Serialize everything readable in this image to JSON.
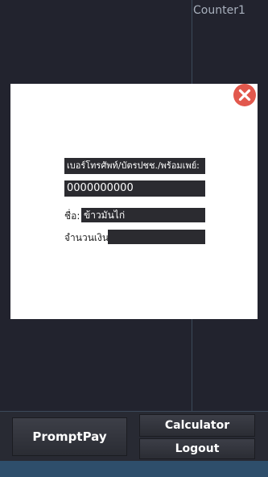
{
  "header": {
    "counter_label": "Counter1"
  },
  "dialog": {
    "close_icon": "close-icon",
    "close_color": "#e2584d",
    "phone_label": "เบอร์โทรศัพท์/บัตรปชช./พร้อมเพย์:",
    "phone_value": "0000000000",
    "name_label": "ชื่อ:",
    "name_value": "ข้าวมันไก่",
    "amount_label": "จำนวนเงิน:",
    "amount_value": ""
  },
  "buttons": {
    "promptpay": "PromptPay",
    "calculator": "Calculator",
    "logout": "Logout"
  },
  "colors": {
    "background": "#22232e",
    "footer": "#2e4e6b"
  }
}
